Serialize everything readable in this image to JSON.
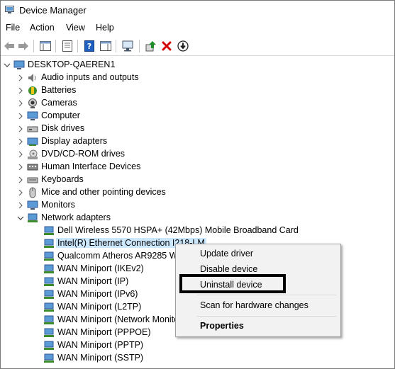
{
  "window": {
    "title": "Device Manager"
  },
  "menu": [
    "File",
    "Action",
    "View",
    "Help"
  ],
  "toolbar": {
    "icons": [
      "back-arrow-icon",
      "forward-arrow-icon",
      "show-hide-console-tree-icon",
      "properties-icon",
      "help-icon",
      "action-pane-icon",
      "scan-hardware-icon",
      "update-driver-icon",
      "uninstall-x-icon",
      "disable-device-icon"
    ],
    "colors": {
      "uninstall": "#d40000",
      "help": "#1f5fbf",
      "update": "#1a8f2a"
    }
  },
  "tree": {
    "root": "DESKTOP-QAEREN1",
    "categories": [
      "Audio inputs and outputs",
      "Batteries",
      "Cameras",
      "Computer",
      "Disk drives",
      "Display adapters",
      "DVD/CD-ROM drives",
      "Human Interface Devices",
      "Keyboards",
      "Mice and other pointing devices",
      "Monitors",
      "Network adapters"
    ],
    "expanded_category": "Network adapters",
    "network_devices": [
      "Dell Wireless 5570 HSPA+ (42Mbps) Mobile Broadband Card",
      "Intel(R) Ethernet Connection I218-LM",
      "Qualcomm Atheros AR9285 Wireless Network Adapter",
      "WAN Miniport (IKEv2)",
      "WAN Miniport (IP)",
      "WAN Miniport (IPv6)",
      "WAN Miniport (L2TP)",
      "WAN Miniport (Network Monitor)",
      "WAN Miniport (PPPOE)",
      "WAN Miniport (PPTP)",
      "WAN Miniport (SSTP)"
    ],
    "selected_device": "Intel(R) Ethernet Connection I218-LM",
    "selection_color": "#cce8ff"
  },
  "context_menu": {
    "items": [
      "Update driver",
      "Disable device",
      "Uninstall device",
      "Scan for hardware changes",
      "Properties"
    ],
    "highlighted": "Uninstall device"
  }
}
